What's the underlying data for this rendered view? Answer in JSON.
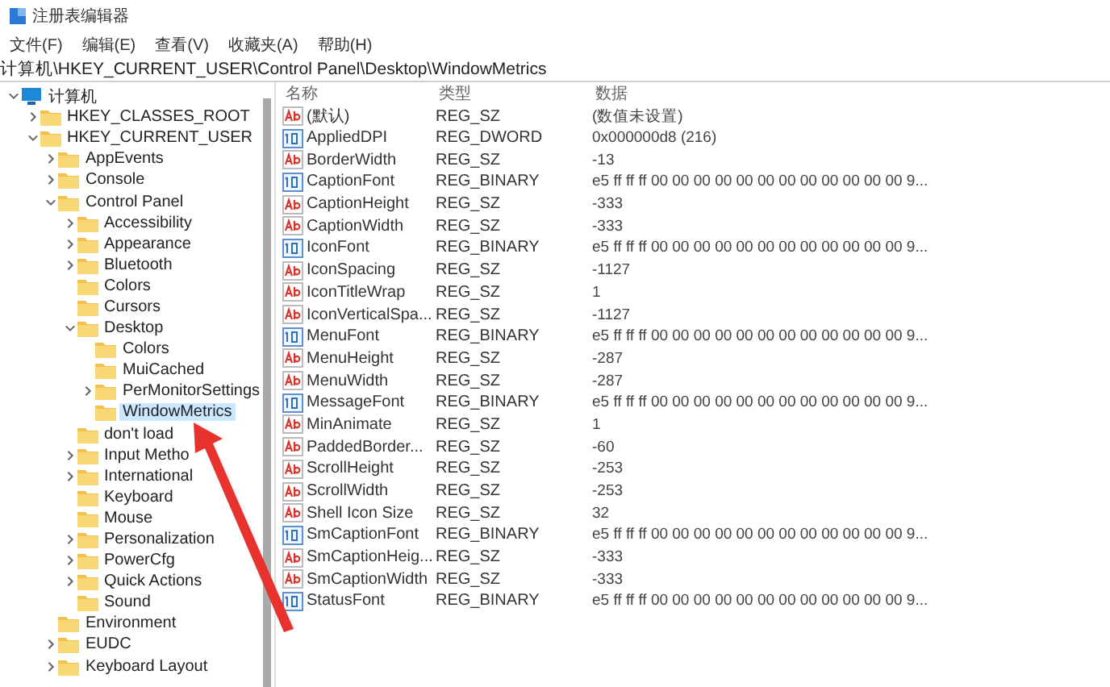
{
  "window": {
    "title": "注册表编辑器"
  },
  "menu": [
    "文件(F)",
    "编辑(E)",
    "查看(V)",
    "收藏夹(A)",
    "帮助(H)"
  ],
  "address": "计算机\\HKEY_CURRENT_USER\\Control Panel\\Desktop\\WindowMetrics",
  "tree": [
    {
      "label": "计算机",
      "kind": "computer",
      "has_children": true,
      "expanded": true,
      "selected": false,
      "children": [
        {
          "label": "HKEY_CLASSES_ROOT",
          "kind": "folder",
          "has_children": true,
          "expanded": false,
          "selected": false
        },
        {
          "label": "HKEY_CURRENT_USER",
          "kind": "folder",
          "has_children": true,
          "expanded": true,
          "selected": false,
          "children": [
            {
              "label": "AppEvents",
              "kind": "folder",
              "has_children": true,
              "expanded": false,
              "selected": false
            },
            {
              "label": "Console",
              "kind": "folder",
              "has_children": true,
              "expanded": false,
              "selected": false
            },
            {
              "label": "Control Panel",
              "kind": "folder",
              "has_children": true,
              "expanded": true,
              "selected": false,
              "children": [
                {
                  "label": "Accessibility",
                  "kind": "folder",
                  "has_children": true,
                  "expanded": false,
                  "selected": false
                },
                {
                  "label": "Appearance",
                  "kind": "folder",
                  "has_children": true,
                  "expanded": false,
                  "selected": false
                },
                {
                  "label": "Bluetooth",
                  "kind": "folder",
                  "has_children": true,
                  "expanded": false,
                  "selected": false
                },
                {
                  "label": "Colors",
                  "kind": "folder",
                  "has_children": false,
                  "selected": false
                },
                {
                  "label": "Cursors",
                  "kind": "folder",
                  "has_children": false,
                  "selected": false
                },
                {
                  "label": "Desktop",
                  "kind": "folder",
                  "has_children": true,
                  "expanded": true,
                  "selected": false,
                  "children": [
                    {
                      "label": "Colors",
                      "kind": "folder",
                      "has_children": false,
                      "selected": false
                    },
                    {
                      "label": "MuiCached",
                      "kind": "folder",
                      "has_children": false,
                      "selected": false
                    },
                    {
                      "label": "PerMonitorSettings",
                      "kind": "folder",
                      "has_children": true,
                      "expanded": false,
                      "selected": false
                    },
                    {
                      "label": "WindowMetrics",
                      "kind": "folder",
                      "has_children": false,
                      "selected": true
                    }
                  ]
                },
                {
                  "label": "don't load",
                  "kind": "folder",
                  "has_children": false,
                  "selected": false
                },
                {
                  "label": "Input Metho",
                  "kind": "folder",
                  "has_children": true,
                  "expanded": false,
                  "selected": false
                },
                {
                  "label": "International",
                  "kind": "folder",
                  "has_children": true,
                  "expanded": false,
                  "selected": false
                },
                {
                  "label": "Keyboard",
                  "kind": "folder",
                  "has_children": false,
                  "selected": false
                },
                {
                  "label": "Mouse",
                  "kind": "folder",
                  "has_children": false,
                  "selected": false
                },
                {
                  "label": "Personalization",
                  "kind": "folder",
                  "has_children": true,
                  "expanded": false,
                  "selected": false
                },
                {
                  "label": "PowerCfg",
                  "kind": "folder",
                  "has_children": true,
                  "expanded": false,
                  "selected": false
                },
                {
                  "label": "Quick Actions",
                  "kind": "folder",
                  "has_children": true,
                  "expanded": false,
                  "selected": false
                },
                {
                  "label": "Sound",
                  "kind": "folder",
                  "has_children": false,
                  "selected": false
                }
              ]
            },
            {
              "label": "Environment",
              "kind": "folder",
              "has_children": false,
              "selected": false
            },
            {
              "label": "EUDC",
              "kind": "folder",
              "has_children": true,
              "expanded": false,
              "selected": false
            },
            {
              "label": "Keyboard Layout",
              "kind": "folder",
              "has_children": true,
              "expanded": false,
              "selected": false
            }
          ]
        }
      ]
    }
  ],
  "columns": [
    "名称",
    "类型",
    "数据"
  ],
  "values": [
    {
      "name": "(默认)",
      "type": "REG_SZ",
      "data": "(数值未设置)",
      "kind": "string"
    },
    {
      "name": "AppliedDPI",
      "type": "REG_DWORD",
      "data": "0x000000d8 (216)",
      "kind": "binary"
    },
    {
      "name": "BorderWidth",
      "type": "REG_SZ",
      "data": "-13",
      "kind": "string"
    },
    {
      "name": "CaptionFont",
      "type": "REG_BINARY",
      "data": "e5 ff ff ff 00 00 00 00 00 00 00 00 00 00 00 00 9...",
      "kind": "binary"
    },
    {
      "name": "CaptionHeight",
      "type": "REG_SZ",
      "data": "-333",
      "kind": "string"
    },
    {
      "name": "CaptionWidth",
      "type": "REG_SZ",
      "data": "-333",
      "kind": "string"
    },
    {
      "name": "IconFont",
      "type": "REG_BINARY",
      "data": "e5 ff ff ff 00 00 00 00 00 00 00 00 00 00 00 00 9...",
      "kind": "binary"
    },
    {
      "name": "IconSpacing",
      "type": "REG_SZ",
      "data": "-1127",
      "kind": "string"
    },
    {
      "name": "IconTitleWrap",
      "type": "REG_SZ",
      "data": "1",
      "kind": "string"
    },
    {
      "name": "IconVerticalSpa...",
      "type": "REG_SZ",
      "data": "-1127",
      "kind": "string"
    },
    {
      "name": "MenuFont",
      "type": "REG_BINARY",
      "data": "e5 ff ff ff 00 00 00 00 00 00 00 00 00 00 00 00 9...",
      "kind": "binary"
    },
    {
      "name": "MenuHeight",
      "type": "REG_SZ",
      "data": "-287",
      "kind": "string"
    },
    {
      "name": "MenuWidth",
      "type": "REG_SZ",
      "data": "-287",
      "kind": "string"
    },
    {
      "name": "MessageFont",
      "type": "REG_BINARY",
      "data": "e5 ff ff ff 00 00 00 00 00 00 00 00 00 00 00 00 9...",
      "kind": "binary"
    },
    {
      "name": "MinAnimate",
      "type": "REG_SZ",
      "data": "1",
      "kind": "string"
    },
    {
      "name": "PaddedBorder...",
      "type": "REG_SZ",
      "data": "-60",
      "kind": "string"
    },
    {
      "name": "ScrollHeight",
      "type": "REG_SZ",
      "data": "-253",
      "kind": "string"
    },
    {
      "name": "ScrollWidth",
      "type": "REG_SZ",
      "data": "-253",
      "kind": "string"
    },
    {
      "name": "Shell Icon Size",
      "type": "REG_SZ",
      "data": "32",
      "kind": "string"
    },
    {
      "name": "SmCaptionFont",
      "type": "REG_BINARY",
      "data": "e5 ff ff ff 00 00 00 00 00 00 00 00 00 00 00 00 9...",
      "kind": "binary"
    },
    {
      "name": "SmCaptionHeig...",
      "type": "REG_SZ",
      "data": "-333",
      "kind": "string"
    },
    {
      "name": "SmCaptionWidth",
      "type": "REG_SZ",
      "data": "-333",
      "kind": "string"
    },
    {
      "name": "StatusFont",
      "type": "REG_BINARY",
      "data": "e5 ff ff ff 00 00 00 00 00 00 00 00 00 00 00 00 9...",
      "kind": "binary"
    }
  ]
}
